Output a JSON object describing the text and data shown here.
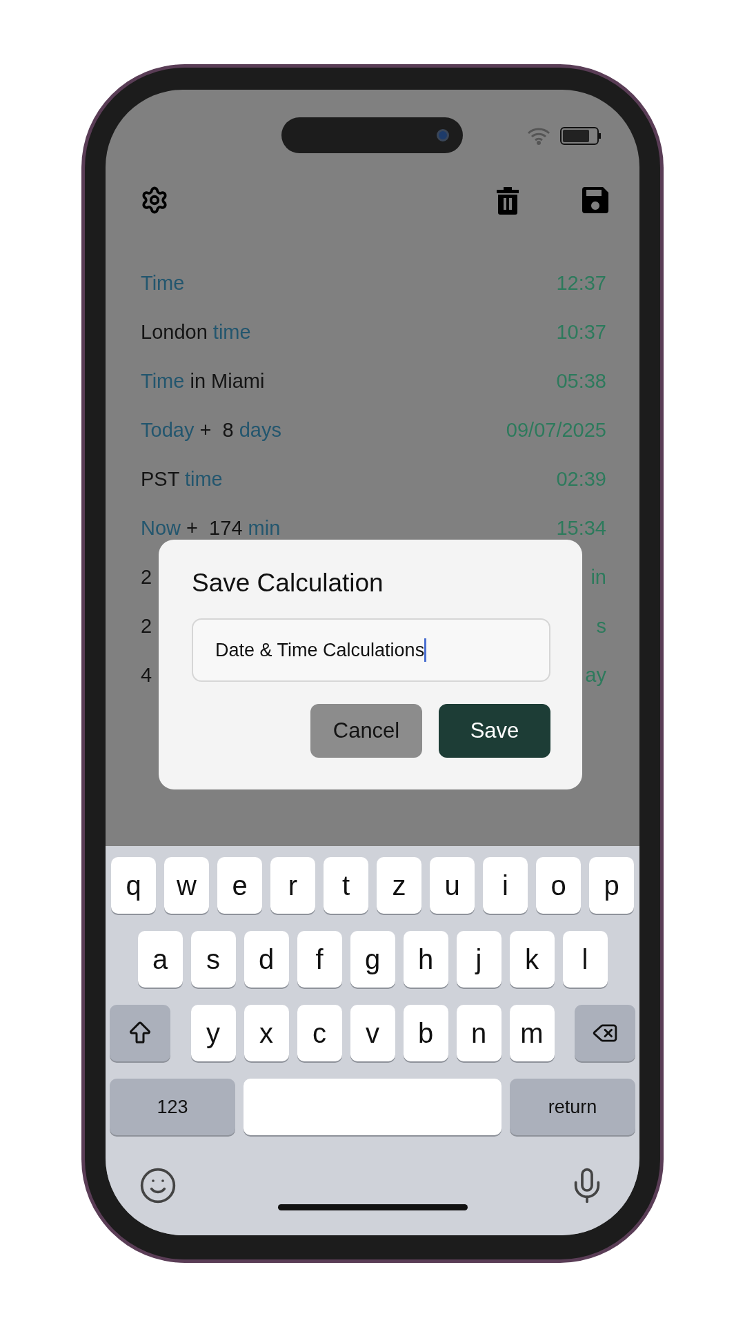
{
  "toolbar": {
    "buttons": [
      {
        "kind": "settings"
      },
      {
        "kind": "delete"
      },
      {
        "kind": "save"
      }
    ]
  },
  "rows": [
    {
      "label": [
        {
          "text": "Time",
          "kind": "keyword"
        }
      ],
      "value": "12:37"
    },
    {
      "label": [
        {
          "text": "London ",
          "kind": "plain"
        },
        {
          "text": "time",
          "kind": "keyword"
        }
      ],
      "value": "10:37"
    },
    {
      "label": [
        {
          "text": "Time",
          "kind": "keyword"
        },
        {
          "text": " in Miami",
          "kind": "plain"
        }
      ],
      "value": "05:38"
    },
    {
      "label": [
        {
          "text": "Today",
          "kind": "keyword"
        },
        {
          "text": " +  8 ",
          "kind": "plain"
        },
        {
          "text": "days",
          "kind": "keyword"
        }
      ],
      "value": "09/07/2025"
    },
    {
      "label": [
        {
          "text": "PST ",
          "kind": "plain"
        },
        {
          "text": "time",
          "kind": "keyword"
        }
      ],
      "value": "02:39"
    },
    {
      "label": [
        {
          "text": "Now",
          "kind": "keyword"
        },
        {
          "text": " +  174 ",
          "kind": "plain"
        },
        {
          "text": "min",
          "kind": "keyword"
        }
      ],
      "value": "15:34"
    },
    {
      "label": [
        {
          "text": "2",
          "kind": "plain"
        }
      ],
      "value": "in"
    },
    {
      "label": [
        {
          "text": "2",
          "kind": "plain"
        }
      ],
      "value": "s"
    },
    {
      "label": [
        {
          "text": "4",
          "kind": "plain"
        }
      ],
      "value": "ay"
    }
  ],
  "dialog": {
    "title": "Save Calculation",
    "field": {
      "value": "Date & Time Calculations"
    },
    "buttons": [
      {
        "label": "Cancel",
        "kind": "secondary"
      },
      {
        "label": "Save",
        "kind": "primary"
      }
    ]
  },
  "keyboard": {
    "letter_rows": [
      [
        "q",
        "w",
        "e",
        "r",
        "t",
        "z",
        "u",
        "i",
        "o",
        "p"
      ],
      [
        "a",
        "s",
        "d",
        "f",
        "g",
        "h",
        "j",
        "k",
        "l"
      ],
      [
        "y",
        "x",
        "c",
        "v",
        "b",
        "n",
        "m"
      ]
    ],
    "numbers_key": "123",
    "return_key": "return"
  }
}
